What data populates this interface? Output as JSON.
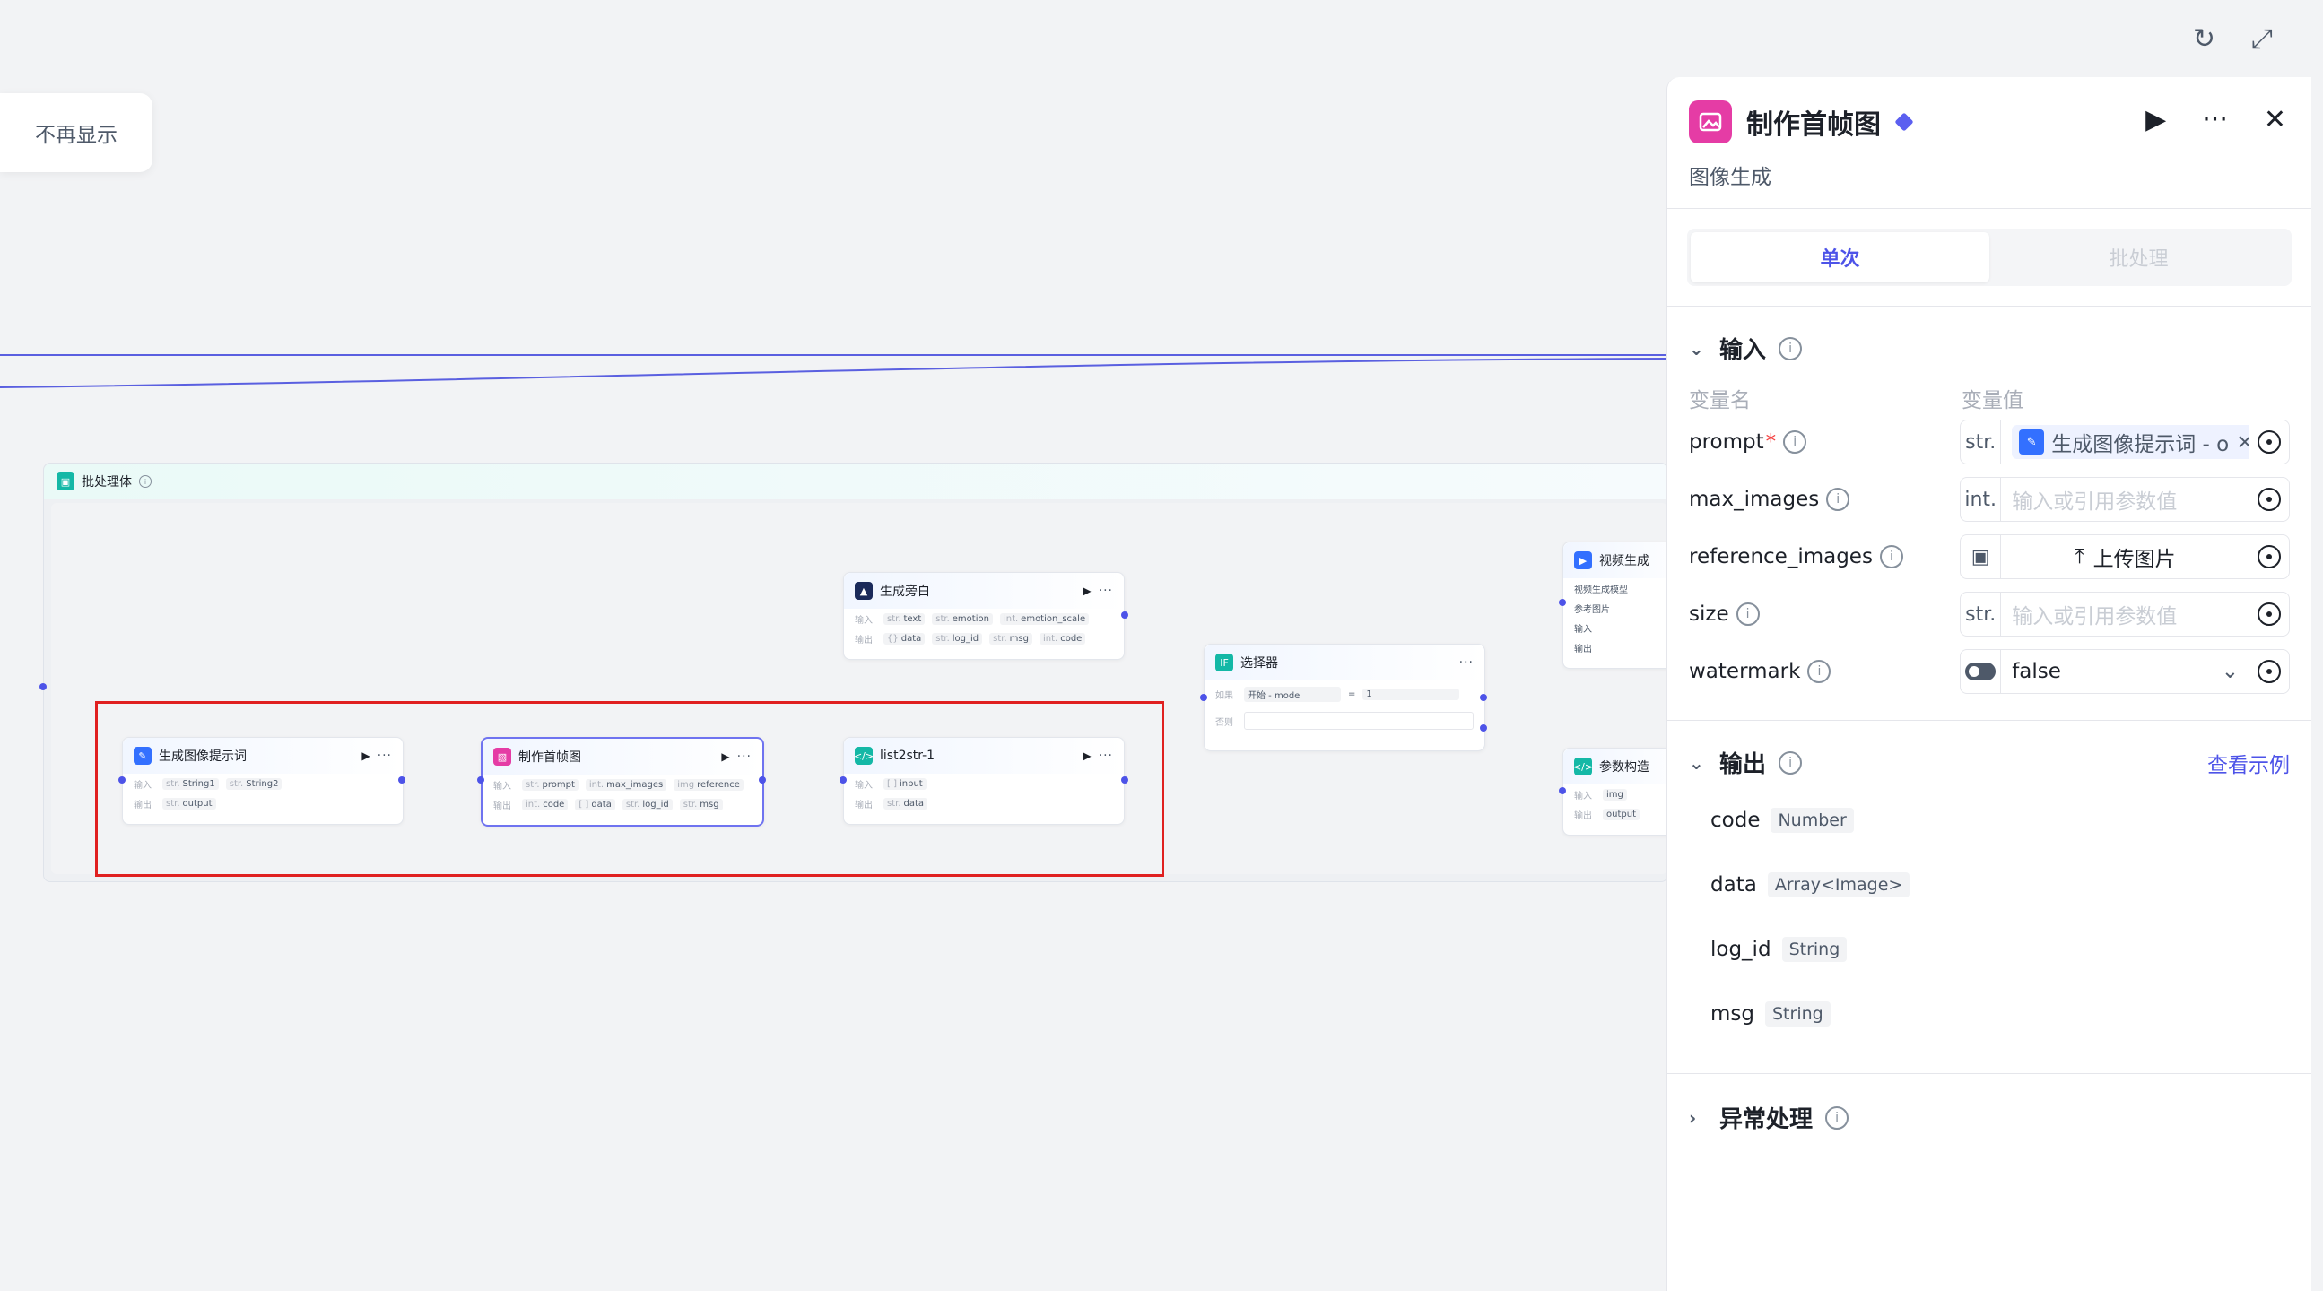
{
  "notice": {
    "label": "不再显示"
  },
  "batch": {
    "title": "批处理体"
  },
  "nodes": {
    "prompt_gen": {
      "title": "生成图像提示词",
      "in_label": "输入",
      "out_label": "输出",
      "inputs": [
        "String1",
        "String2"
      ],
      "outputs": [
        "output"
      ]
    },
    "first_frame": {
      "title": "制作首帧图",
      "in_label": "输入",
      "out_label": "输出",
      "inputs": [
        "prompt",
        "max_images",
        "reference"
      ],
      "outputs": [
        "code",
        "data",
        "log_id",
        "msg"
      ]
    },
    "list2str": {
      "title": "list2str-1",
      "in_label": "输入",
      "out_label": "输出",
      "inputs": [
        "input"
      ],
      "outputs": [
        "data"
      ]
    },
    "narration": {
      "title": "生成旁白",
      "in_label": "输入",
      "out_label": "输出",
      "inputs": [
        "text",
        "emotion",
        "emotion_scale"
      ],
      "outputs": [
        "data",
        "log_id",
        "msg",
        "code"
      ]
    },
    "selector": {
      "title": "选择器",
      "if_label": "如果",
      "else_label": "否则",
      "cond_left": "开始 - mode",
      "cond_op": "=",
      "cond_right": "1"
    },
    "video": {
      "title": "视频生成",
      "r1": "视频生成模型",
      "r2": "参考图片",
      "r3": "输入",
      "r4": "输出"
    },
    "params": {
      "title": "参数构造",
      "in_label": "输入",
      "out_label": "输出",
      "inputs": [
        "img"
      ],
      "outputs": [
        "output"
      ]
    }
  },
  "panel": {
    "title": "制作首帧图",
    "subtitle": "图像生成",
    "tabs": {
      "single": "单次",
      "batch": "批处理"
    },
    "input_section": "输入",
    "col_name": "变量名",
    "col_value": "变量值",
    "inputs": [
      {
        "name": "prompt",
        "required": "*",
        "type": "str.",
        "value": "生成图像提示词 - o"
      },
      {
        "name": "max_images",
        "type": "int.",
        "placeholder": "输入或引用参数值"
      },
      {
        "name": "reference_images",
        "upload": "上传图片"
      },
      {
        "name": "size",
        "type": "str.",
        "placeholder": "输入或引用参数值"
      },
      {
        "name": "watermark",
        "value": "false"
      }
    ],
    "output_section": "输出",
    "example_link": "查看示例",
    "outputs": [
      {
        "name": "code",
        "type": "Number"
      },
      {
        "name": "data",
        "type": "Array<Image>"
      },
      {
        "name": "log_id",
        "type": "String"
      },
      {
        "name": "msg",
        "type": "String"
      }
    ],
    "error_section": "异常处理"
  },
  "colors": {
    "accent": "#4d53e8",
    "highlight_box": "#e02020",
    "node_pink": "#e53ca5",
    "node_blue": "#3370ff",
    "node_teal": "#14b8a6"
  }
}
